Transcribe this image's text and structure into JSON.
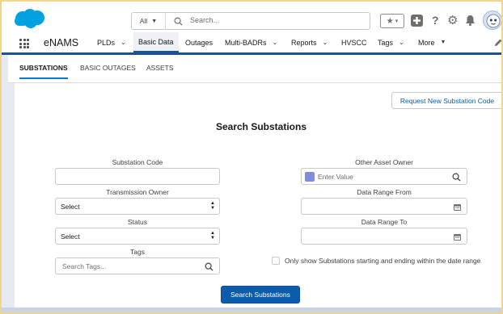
{
  "header": {
    "search_scope": "All",
    "search_placeholder": "Search..."
  },
  "app": {
    "name": "eNAMS",
    "nav": [
      {
        "label": "PLDs",
        "dropdown": true
      },
      {
        "label": "Basic Data",
        "dropdown": false,
        "active": true
      },
      {
        "label": "Outages",
        "dropdown": false
      },
      {
        "label": "Multi-BADRs",
        "dropdown": true
      },
      {
        "label": "Reports",
        "dropdown": true
      },
      {
        "label": "HVSCC",
        "dropdown": false
      },
      {
        "label": "Tags",
        "dropdown": true
      },
      {
        "label": "More",
        "dropdown": true
      }
    ]
  },
  "tabs": [
    {
      "label": "SUBSTATIONS",
      "active": true
    },
    {
      "label": "BASIC OUTAGES",
      "active": false
    },
    {
      "label": "ASSETS",
      "active": false
    }
  ],
  "page": {
    "request_button": "Request New Substation Code",
    "title": "Search Substations",
    "fields": {
      "substation_code": {
        "label": "Substation Code",
        "value": ""
      },
      "transmission_owner": {
        "label": "Transmission Owner",
        "value": "Select"
      },
      "status": {
        "label": "Status",
        "value": "Select"
      },
      "tags": {
        "label": "Tags",
        "placeholder": "Search Tags..."
      },
      "other_asset_owner": {
        "label": "Other Asset Owner",
        "placeholder": "Enter Value"
      },
      "date_from": {
        "label": "Data Range From",
        "value": ""
      },
      "date_to": {
        "label": "Data Range To",
        "value": ""
      }
    },
    "checkbox_label": "Only show Substations starting and ending within the date range",
    "submit": "Search Substations"
  },
  "colors": {
    "brand": "#0b5cab",
    "nav_underline": "#1b5297",
    "frame": "#f2d58a",
    "cloud": "#00a1e0"
  }
}
